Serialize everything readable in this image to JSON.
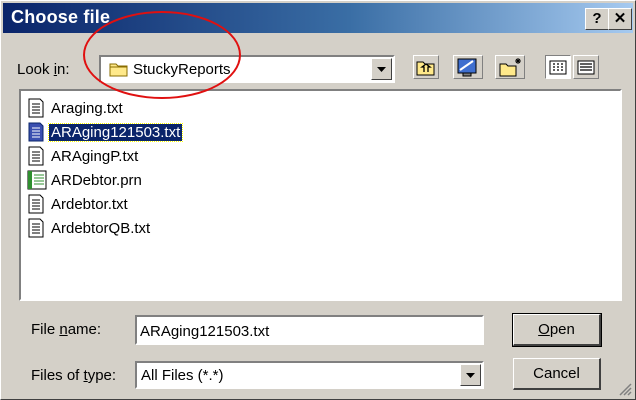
{
  "window": {
    "title": "Choose file",
    "help_label": "?",
    "close_label": "✕"
  },
  "lookin": {
    "label_pre": "Look ",
    "label_u": "i",
    "label_post": "n:",
    "value": "StuckyReports",
    "icon": "folder-icon"
  },
  "toolbar": {
    "icons": [
      "up-folder-icon",
      "desktop-icon",
      "new-folder-icon",
      "list-view-icon",
      "details-view-icon"
    ]
  },
  "files": [
    {
      "name": "Araging.txt",
      "icon": "text-file-icon",
      "selected": false
    },
    {
      "name": "ARAging121503.txt",
      "icon": "text-file-icon",
      "selected": true
    },
    {
      "name": "ARAgingP.txt",
      "icon": "text-file-icon",
      "selected": false
    },
    {
      "name": "ARDebtor.prn",
      "icon": "data-file-icon",
      "selected": false
    },
    {
      "name": "Ardebtor.txt",
      "icon": "text-file-icon",
      "selected": false
    },
    {
      "name": "ArdebtorQB.txt",
      "icon": "text-file-icon",
      "selected": false
    }
  ],
  "filename": {
    "label_pre": "File ",
    "label_u": "n",
    "label_post": "ame:",
    "value": "ARAging121503.txt"
  },
  "filetype": {
    "label_pre": "Files of ",
    "label_u": "t",
    "label_post": "ype:",
    "value": "All Files (*.*)"
  },
  "buttons": {
    "open_u": "O",
    "open_rest": "pen",
    "cancel": "Cancel"
  },
  "colors": {
    "title_start": "#0a246a",
    "title_end": "#a6caf0",
    "face": "#d4d0c8",
    "selection": "#0a246a",
    "annotation": "#e01010"
  }
}
